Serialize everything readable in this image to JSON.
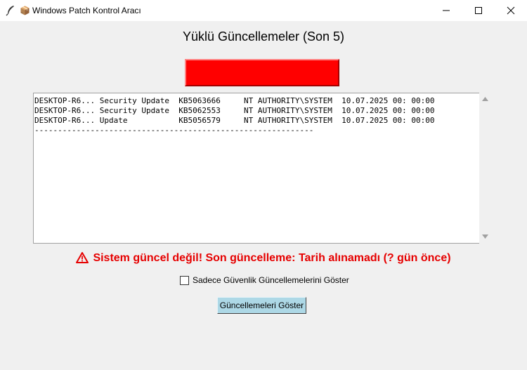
{
  "window": {
    "title": "Windows Patch Kontrol Aracı",
    "title_glyph": "📦",
    "icons": [
      "feather-icon",
      "package-icon",
      "minimize-icon",
      "maximize-icon",
      "close-icon"
    ]
  },
  "header": {
    "title": "Yüklü Güncellemeler (Son 5)"
  },
  "status_indicator": {
    "color": "#ff0000"
  },
  "updates_list": {
    "lines": [
      "DESKTOP-R6... Security Update  KB5063666     NT AUTHORITY\\SYSTEM  10.07.2025 00: 00:00",
      "DESKTOP-R6... Security Update  KB5062553     NT AUTHORITY\\SYSTEM  10.07.2025 00: 00:00",
      "DESKTOP-R6... Update           KB5056579     NT AUTHORITY\\SYSTEM  10.07.2025 00: 00:00",
      "------------------------------------------------------------"
    ]
  },
  "warning": {
    "text": "Sistem güncel değil! Son güncelleme: Tarih alınamadı (? gün önce)",
    "icon": "warning-icon",
    "color": "#e60000"
  },
  "filter": {
    "label": "Sadece Güvenlik Güncellemelerini Göster",
    "checked": false
  },
  "actions": {
    "show_label": "Güncellemeleri Göster",
    "button_color": "#add8e6"
  }
}
